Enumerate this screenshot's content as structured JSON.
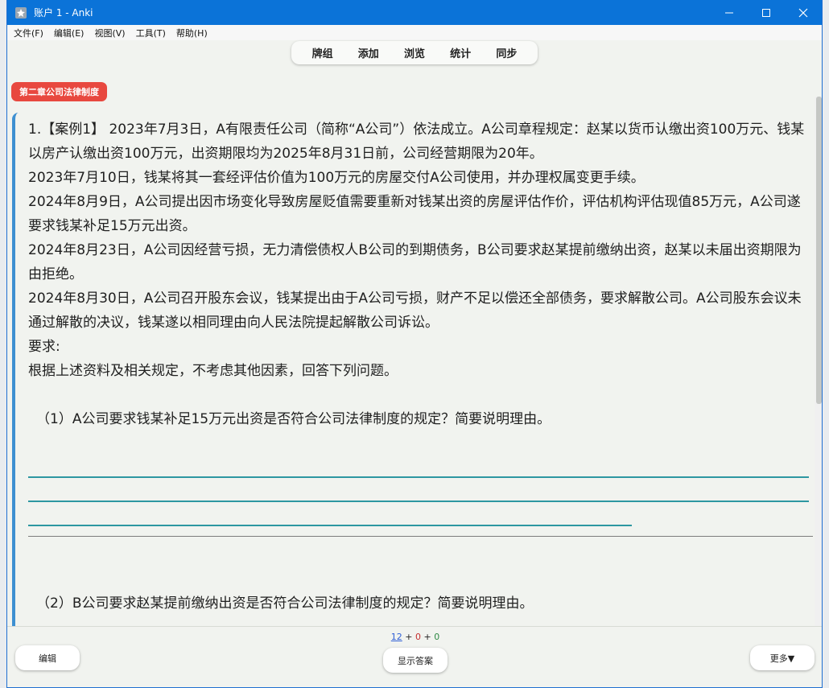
{
  "window": {
    "title": "账户 1 - Anki"
  },
  "menu": [
    "文件(F)",
    "编辑(E)",
    "视图(V)",
    "工具(T)",
    "帮助(H)"
  ],
  "toolbar": [
    "牌组",
    "添加",
    "浏览",
    "统计",
    "同步"
  ],
  "tag": "第二章公司法律制度",
  "card": {
    "paragraphs": [
      "1.【案例1】 2023年7月3日，A有限责任公司（简称“A公司”）依法成立。A公司章程规定：赵某以货币认缴出资100万元、钱某以房产认缴出资100万元，出资期限均为2025年8月31日前，公司经营期限为20年。",
      "2023年7月10日，钱某将其一套经评估价值为100万元的房屋交付A公司使用，并办理权属变更手续。",
      "2024年8月9日，A公司提出因市场变化导致房屋贬值需要重新对钱某出资的房屋评估作价，评估机构评估现值85万元，A公司遂要求钱某补足15万元出资。",
      "2024年8月23日，A公司因经营亏损，无力清偿债权人B公司的到期债务，B公司要求赵某提前缴纳出资，赵某以未届出资期限为由拒绝。",
      "2024年8月30日，A公司召开股东会议，钱某提出由于A公司亏损，财产不足以偿还全部债务，要求解散公司。A公司股东会议未通过解散的决议，钱某遂以相同理由向人民法院提起解散公司诉讼。",
      "要求:",
      "根据上述资料及相关规定，不考虑其他因素，回答下列问题。"
    ],
    "question1": "（1）A公司要求钱某补足15万元出资是否符合公司法律制度的规定？简要说明理由。",
    "question2": "（2）B公司要求赵某提前缴纳出资是否符合公司法律制度的规定？简要说明理由。"
  },
  "bottom": {
    "edit": "编辑",
    "show_answer": "显示答案",
    "more": "更多▼",
    "count_new": "12",
    "count_learn": "0",
    "count_review": "0",
    "plus": "+"
  },
  "colors": {
    "titlebar": "#0b73d8",
    "tag": "#e8483f",
    "card_border": "#3d8fd1",
    "answer_line": "#2d97a1"
  },
  "icons": {
    "app": "anki-star-icon",
    "minimize": "minimize-icon",
    "maximize": "maximize-icon",
    "close": "close-icon"
  }
}
